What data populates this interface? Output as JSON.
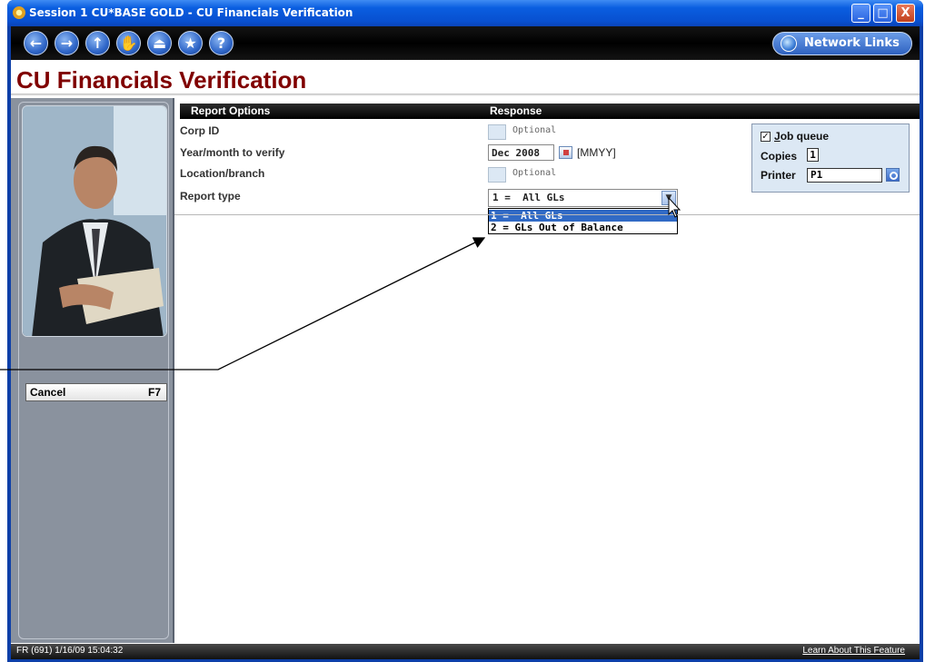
{
  "window": {
    "title": "Session 1 CU*BASE GOLD - CU Financials Verification",
    "buttons": [
      "_",
      "□",
      "X"
    ]
  },
  "toolbar": {
    "nav_glyphs": [
      "←",
      "→",
      "↑",
      "✋",
      "⏏",
      "★",
      "?"
    ],
    "network_links_label": "Network Links"
  },
  "page": {
    "title": "CU Financials Verification"
  },
  "sidebar": {
    "cancel_label": "Cancel",
    "cancel_key": "F7"
  },
  "form": {
    "headers": {
      "options": "Report Options",
      "response": "Response"
    },
    "corp_id": {
      "label": "Corp ID",
      "placeholder": "Optional"
    },
    "year_month": {
      "label": "Year/month to verify",
      "value": "Dec 2008",
      "format": "[MMYY]"
    },
    "location": {
      "label": "Location/branch",
      "placeholder": "Optional"
    },
    "report_type": {
      "label": "Report type",
      "selected": "1 =  All GLs",
      "options": [
        "1 =  All GLs",
        "2 = GLs Out of Balance"
      ]
    }
  },
  "job_panel": {
    "job_queue_label": "Job queue",
    "job_queue_underline": "J",
    "job_queue_rest": "ob queue",
    "job_queue_checked": true,
    "copies_label": "Copies",
    "copies_value": "1",
    "printer_label": "Printer",
    "printer_value": "P1"
  },
  "status_bar": {
    "left": "FR (691) 1/16/09 15:04:32",
    "right": "Learn About This Feature"
  },
  "colors": {
    "title": "#800000",
    "selection": "#316ac5",
    "sidebar": "#8a929e"
  }
}
